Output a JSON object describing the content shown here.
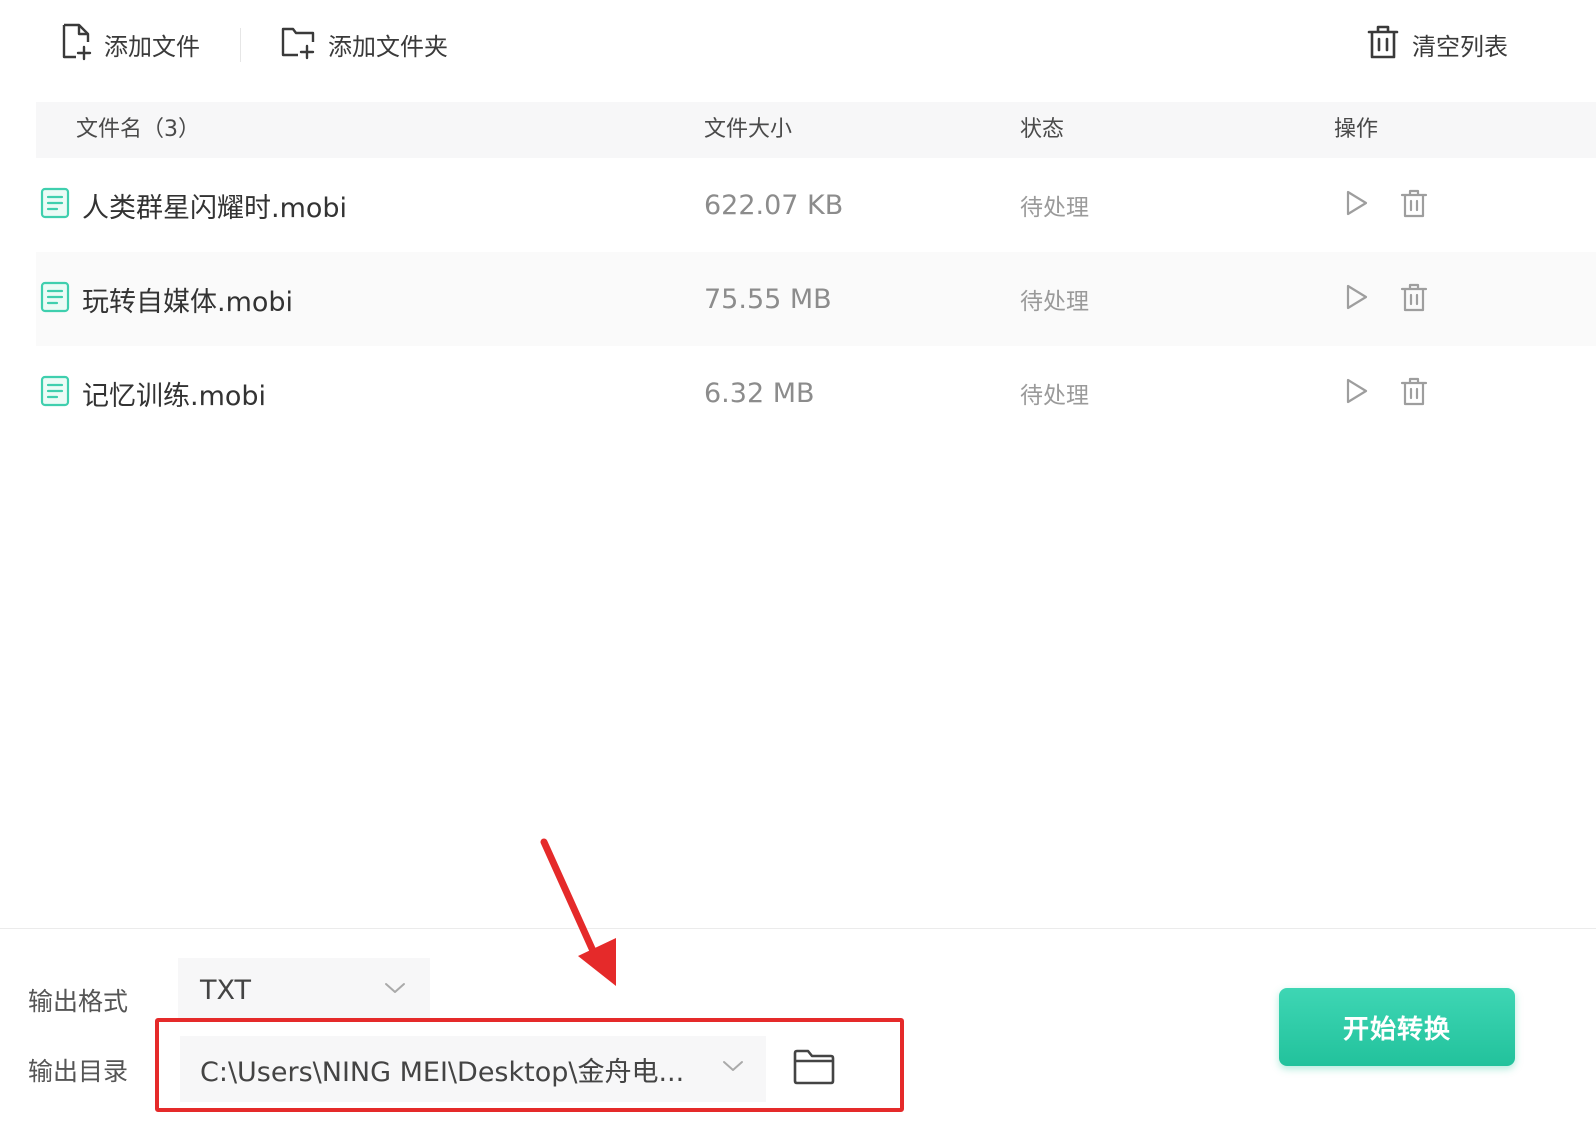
{
  "toolbar": {
    "add_file_label": "添加文件",
    "add_folder_label": "添加文件夹",
    "clear_list_label": "清空列表"
  },
  "table": {
    "headers": {
      "name": "文件名（3）",
      "size": "文件大小",
      "status": "状态",
      "action": "操作"
    },
    "rows": [
      {
        "name": "人类群星闪耀时.mobi",
        "size": "622.07 KB",
        "status": "待处理"
      },
      {
        "name": "玩转自媒体.mobi",
        "size": "75.55 MB",
        "status": "待处理"
      },
      {
        "name": "记忆训练.mobi",
        "size": "6.32 MB",
        "status": "待处理"
      }
    ]
  },
  "footer": {
    "format_label": "输出格式",
    "format_value": "TXT",
    "dir_label": "输出目录",
    "dir_value": "C:\\Users\\NING MEI\\Desktop\\金舟电...",
    "start_label": "开始转换"
  },
  "icons": {
    "add_file": "file-plus-icon",
    "add_folder": "folder-plus-icon",
    "clear": "trash-icon",
    "file_row": "document-icon",
    "play": "play-icon",
    "delete": "trash-icon",
    "dropdown": "chevron-down-icon",
    "browse": "folder-icon"
  },
  "colors": {
    "accent": "#22c29c",
    "accent_light": "#3ed6b4",
    "file_icon": "#3fcfae",
    "annotation": "#e52a2a",
    "header_bg": "#f7f7f8"
  }
}
